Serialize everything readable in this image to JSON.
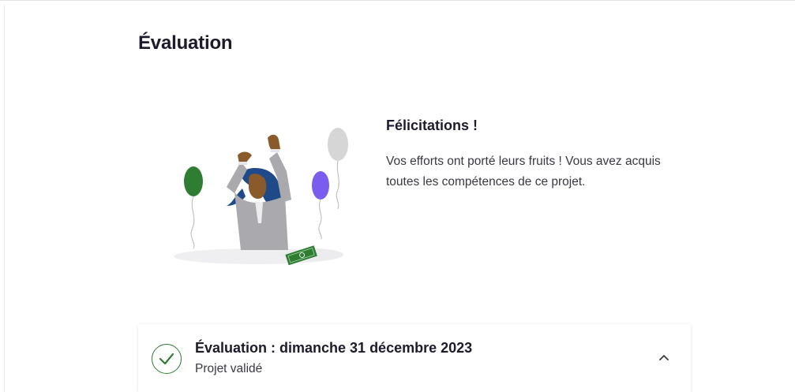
{
  "page": {
    "title": "Évaluation"
  },
  "congrats": {
    "title": "Félicitations !",
    "text": "Vos efforts ont porté leurs fruits ! Vous avez acquis toutes les compétences de ce projet.",
    "illustration": "celebration-illustration"
  },
  "evaluation_card": {
    "title": "Évaluation : dimanche 31 décembre 2023",
    "status": "Projet validé",
    "status_icon": "check-circle-icon",
    "toggle_icon": "chevron-up-icon",
    "expanded": true
  },
  "colors": {
    "accent_green": "#2e7d32",
    "text_dark": "#1d1a2b",
    "text_body": "#3a3744",
    "balloon_green": "#2e7d32",
    "balloon_purple": "#7b5cf0",
    "balloon_grey": "#d6d6d6"
  }
}
